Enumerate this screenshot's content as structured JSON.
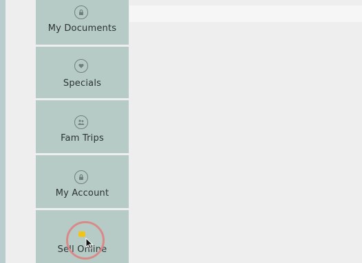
{
  "sidebar": {
    "items": [
      {
        "label": "My Documents",
        "icon": "lock-icon"
      },
      {
        "label": "Specials",
        "icon": "heart-icon"
      },
      {
        "label": "Fam Trips",
        "icon": "people-icon"
      },
      {
        "label": "My Account",
        "icon": "lock-icon"
      },
      {
        "label": "Sell Online",
        "icon": "cart-icon"
      }
    ]
  },
  "colors": {
    "sidebar_bg": "#b6cbc6",
    "frame_bg": "#b9cdcf",
    "content_bg": "#eeeeee",
    "highlight_ring": "#d98a88",
    "sell_icon": "#f0c419"
  }
}
